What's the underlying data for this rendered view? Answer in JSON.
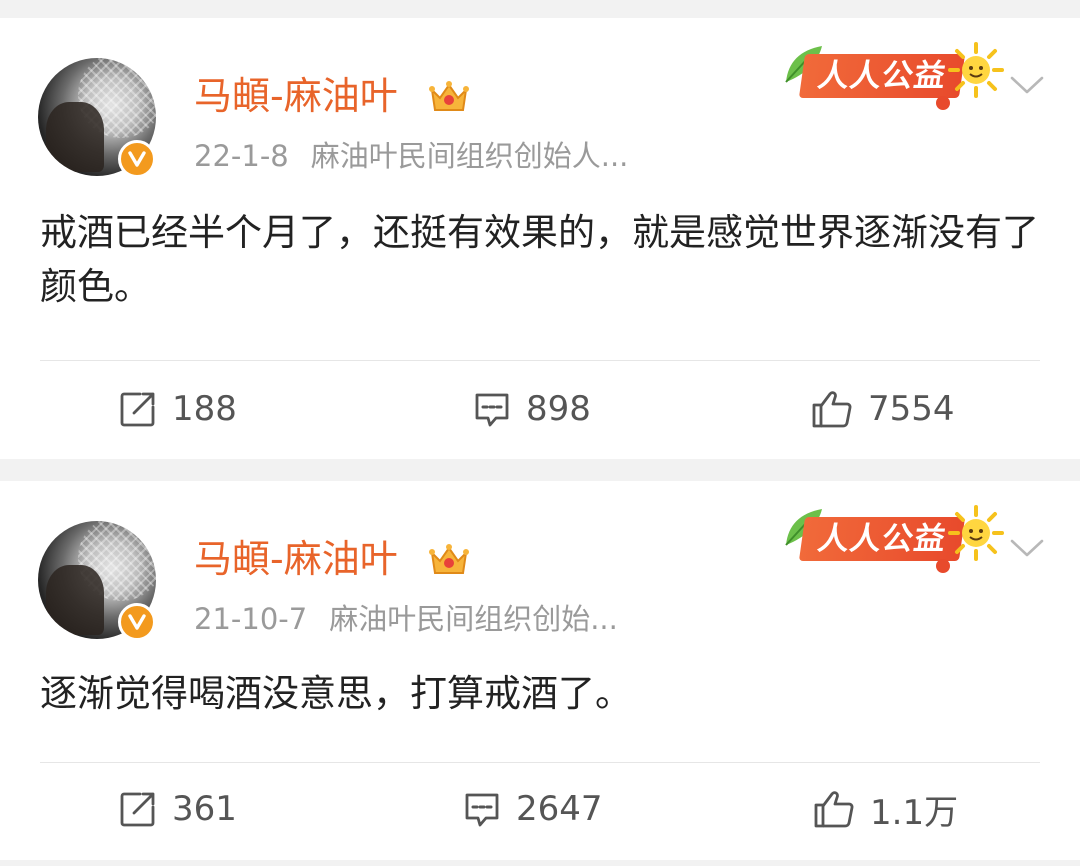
{
  "posts": [
    {
      "author": "马頔-麻油叶",
      "date": "22-1-8",
      "bio": "麻油叶民间组织创始人...",
      "promo_label": "人人公益",
      "text": "戒酒已经半个月了，还挺有效果的，就是感觉世界逐渐没有了颜色。",
      "reposts": "188",
      "comments": "898",
      "likes": "7554"
    },
    {
      "author": "马頔-麻油叶",
      "date": "21-10-7",
      "bio": "麻油叶民间组织创始...",
      "promo_label": "人人公益",
      "text": "逐渐觉得喝酒没意思，打算戒酒了。",
      "reposts": "361",
      "comments": "2647",
      "likes": "1.1万"
    }
  ],
  "colors": {
    "author": "#e8642a",
    "meta": "#9a9a9a",
    "verified_badge": "#f39a1e",
    "promo": "#e84a2c",
    "background": "#f2f2f2"
  },
  "icons": {
    "repost": "repost-icon",
    "comment": "comment-icon",
    "like": "thumbs-up-icon",
    "menu": "chevron-down-icon",
    "verified": "verified-v-icon",
    "vip": "crown-icon"
  }
}
